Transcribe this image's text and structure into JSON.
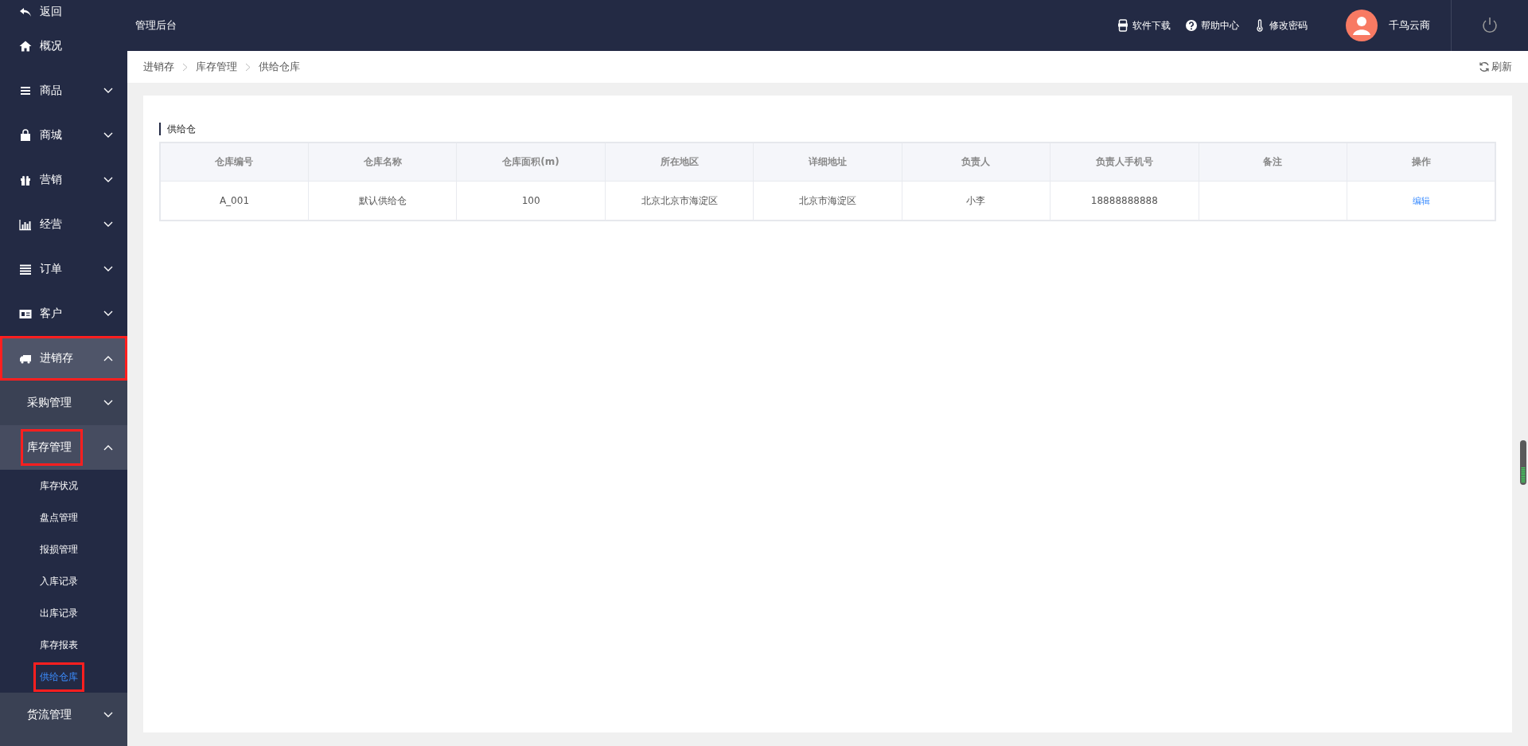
{
  "header": {
    "title": "管理后台",
    "links": [
      {
        "label": "软件下载"
      },
      {
        "label": "帮助中心"
      },
      {
        "label": "修改密码"
      }
    ],
    "user": {
      "name": "千鸟云商"
    }
  },
  "sidebar": {
    "items": [
      {
        "kind": "link",
        "label": "返回",
        "highlighted": false
      },
      {
        "kind": "link",
        "label": "概况",
        "highlighted": false
      },
      {
        "kind": "group",
        "label": "商品",
        "expanded": false,
        "highlighted": false
      },
      {
        "kind": "group",
        "label": "商城",
        "expanded": false,
        "highlighted": false
      },
      {
        "kind": "group",
        "label": "营销",
        "expanded": false,
        "highlighted": false
      },
      {
        "kind": "group",
        "label": "经营",
        "expanded": false,
        "highlighted": false
      },
      {
        "kind": "group",
        "label": "订单",
        "expanded": false,
        "highlighted": false
      },
      {
        "kind": "group",
        "label": "客户",
        "expanded": false,
        "highlighted": false
      },
      {
        "kind": "group",
        "label": "进销存",
        "expanded": true,
        "highlighted": true,
        "children": [
          {
            "label": "采购管理",
            "expanded": false,
            "highlighted": false
          },
          {
            "label": "库存管理",
            "expanded": true,
            "highlighted": true,
            "children": [
              {
                "label": "库存状况",
                "selected": false,
                "highlighted": false
              },
              {
                "label": "盘点管理",
                "selected": false,
                "highlighted": false
              },
              {
                "label": "报损管理",
                "selected": false,
                "highlighted": false
              },
              {
                "label": "入库记录",
                "selected": false,
                "highlighted": false
              },
              {
                "label": "出库记录",
                "selected": false,
                "highlighted": false
              },
              {
                "label": "库存报表",
                "selected": false,
                "highlighted": false
              },
              {
                "label": "供给仓库",
                "selected": true,
                "highlighted": true
              }
            ]
          },
          {
            "label": "货流管理",
            "expanded": false,
            "highlighted": false
          }
        ]
      }
    ]
  },
  "breadcrumb": {
    "items": [
      "进销存",
      "库存管理",
      "供给仓库"
    ],
    "refresh": "刷新"
  },
  "panel": {
    "title": "供给仓",
    "table": {
      "columns": [
        "仓库编号",
        "仓库名称",
        "仓库面积(m)",
        "所在地区",
        "详细地址",
        "负责人",
        "负责人手机号",
        "备注",
        "操作"
      ],
      "rows": [
        {
          "code": "A_001",
          "name": "默认供给仓",
          "area": "100",
          "region": "北京北京市海淀区",
          "address": "北京市海淀区",
          "manager": "小李",
          "phone": "18888888888",
          "action": "编辑"
        }
      ]
    }
  }
}
